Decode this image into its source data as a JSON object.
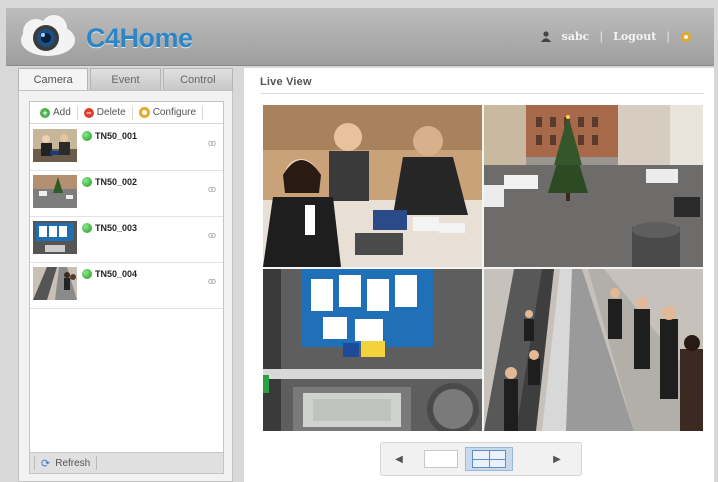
{
  "app": {
    "name": "C4Home"
  },
  "header": {
    "user": "sabc",
    "logout": "Logout",
    "separator": "|"
  },
  "tabs": [
    {
      "label": "Camera",
      "active": true
    },
    {
      "label": "Event",
      "active": false
    },
    {
      "label": "Control",
      "active": false
    }
  ],
  "toolbar": {
    "add": "Add",
    "delete": "Delete",
    "configure": "Configure"
  },
  "cameras": [
    {
      "name": "TN50_001",
      "status": "online",
      "link_icon": "chain-link-icon"
    },
    {
      "name": "TN50_002",
      "status": "online",
      "link_icon": "chain-link-icon"
    },
    {
      "name": "TN50_003",
      "status": "online",
      "link_icon": "chain-link-icon"
    },
    {
      "name": "TN50_004",
      "status": "online",
      "link_icon": "chain-link-icon"
    }
  ],
  "refresh": {
    "label": "Refresh"
  },
  "main": {
    "title": "Live View"
  },
  "live_view": {
    "feeds": [
      {
        "scene": "office meeting"
      },
      {
        "scene": "town square with christmas tree"
      },
      {
        "scene": "shelf with clock and price display"
      },
      {
        "scene": "escalator crowd"
      }
    ],
    "layout_options": [
      {
        "name": "single-view",
        "active": false
      },
      {
        "name": "quad-view",
        "active": true
      }
    ]
  },
  "icons": {
    "user": "user-icon",
    "settings": "gear-icon",
    "refresh": "refresh-icon",
    "prev": "prev-arrow-icon",
    "next": "next-arrow-icon"
  },
  "colors": {
    "brand": "#2b86c7",
    "online": "#2faa2f",
    "delete": "#d9412f",
    "header": "#a8a8a8"
  }
}
